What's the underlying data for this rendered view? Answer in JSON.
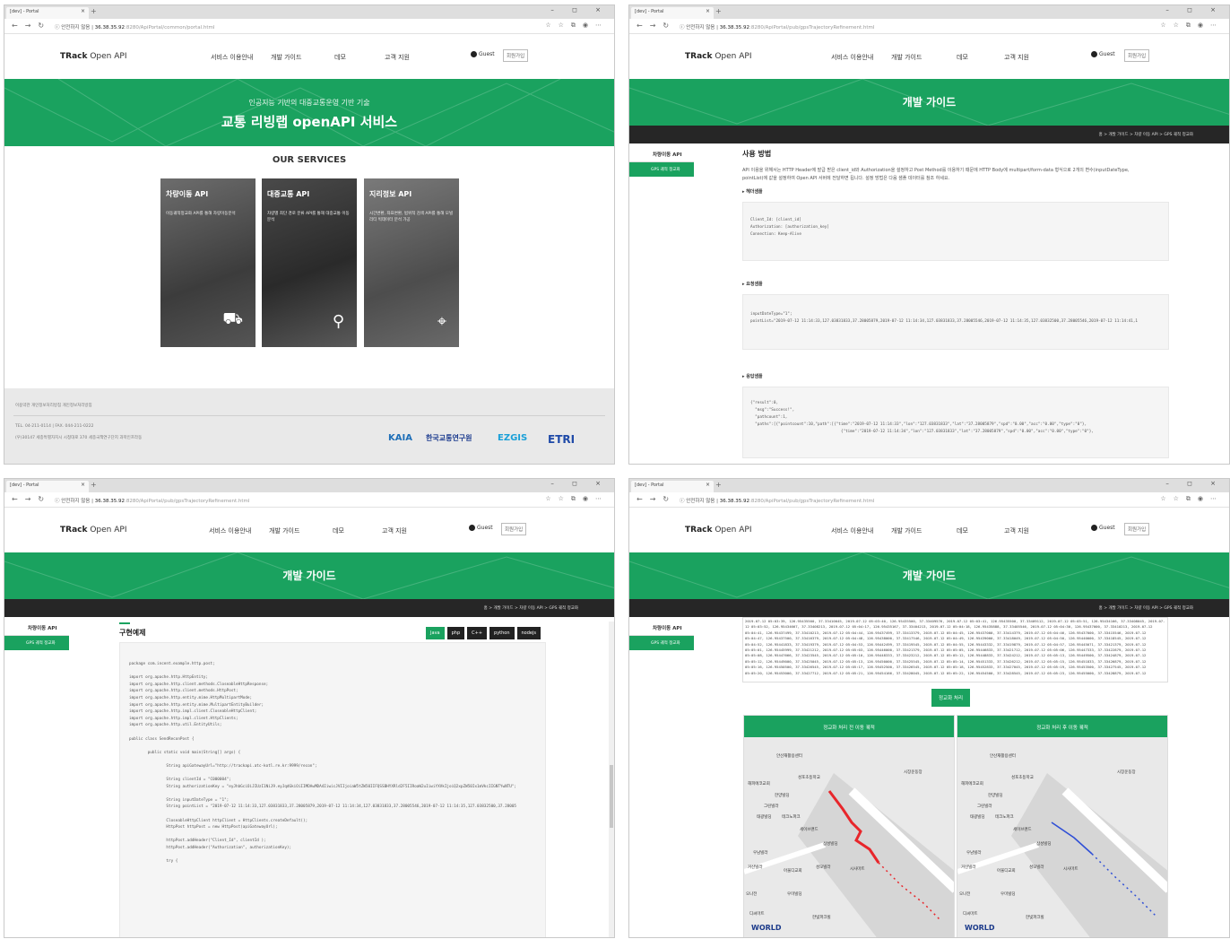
{
  "browser": {
    "tab_label": "[dev] - Portal",
    "tab_close": "×",
    "new_tab": "+",
    "window_controls": "–  ◻  ×",
    "not_secure": "안전하지 않음",
    "host": "36.38.35.92",
    "port_path_portal": ":8280/ApiPortal/common/portal.html",
    "port_path_guide": ":8280/ApiPortal/pub/gpsTrajectoryRefinement.html"
  },
  "site": {
    "logo_bold": "TRack",
    "logo_rest": " Open API",
    "menu": [
      "서비스 이용안내",
      "개발 가이드",
      "데모",
      "고객 지원"
    ],
    "guest": "Guest",
    "join": "회원가입"
  },
  "portal": {
    "hero_sub": "인공지능 기반의 대중교통운영 기반 기술",
    "hero_title": "교통 리빙랩 openAPI 서비스",
    "services_title": "OUR SERVICES",
    "cards": [
      {
        "title": "차량이동 API",
        "desc": "이동궤적정교화 API를 통해 차량이동분석"
      },
      {
        "title": "대중교통 API",
        "desc": "차량별 최단 경로 분류 API를 통해 대중교통 이동분석"
      },
      {
        "title": "지리정보 API",
        "desc": "시간변환, 좌표변환, 범위적 검색 API를 통해 모빌리티 빅데이터 분석 가공"
      }
    ],
    "footer_links": "이용약관   개인정보처리방침   개인정보처리방침",
    "footer_tel": "TEL. 04-211-0114  |  FAX. 044-211-0222",
    "footer_addr": "(우)30147 세종특별자치시 시청대로 370 세종국책연구단지 과학인프라동",
    "partners": [
      "KAIA",
      "한국교통연구원",
      "EZGIS",
      "ETRI"
    ]
  },
  "guide": {
    "page_title": "개발 가이드",
    "breadcrumb": "홈 > 개발 가이드 > 차량 이동 API > GPS 궤적 정교화",
    "side_menu": "차량이동 API",
    "side_active": "GPS 궤적 정교화",
    "usage_title": "사용 방법",
    "usage_text_1": "API 이용을 위해서는 HTTP Header에 발급 받은 client_id와 Authorization을 설정하고 Post Method를 이용하기 때문에 HTTP Body에 multipart/form-data 형식으로 2개의 변수(inputDateType,",
    "usage_text_2": "pointList)에 값을 설정하여 Open API 서버에 전달하면 됩니다. 설정 방법은 다음 샘플 데이터를 참조 하세요.",
    "header_sample_label": "▸ 헤더샘플",
    "header_sample": "Client_Id: [client_id]\nAuthorization: [authorization_key]\nConnection: Keep-Alive",
    "request_sample_label": "▸ 요청샘플",
    "request_sample": "inputDateType=\"1\";\npointList=\"2019-07-12 11:14:33,127.03831833,37.28005879,2019-07-12 11:14:34,127.03831833,37.28005546,2019-07-12 11:14:35,127.03832500,37.28005546,2019-07-12 11:14:41,1",
    "response_sample_label": "▸ 응답샘플",
    "response_sample": "{\"result\":0,\n  \"msg\":\"Success!\",\n  \"pathcount\":1,\n  \"paths\":[{\"pointcount\":10,\"path\":[{\"time\":\"2019-07-12 11:14:33\",\"lon\":\"127.03831833\",\"lat\":\"37.28005879\",\"spd\":\"0.00\",\"acc\":\"0.00\",\"type\":\"0\"},\n                                       {\"time\":\"2019-07-12 11:14:34\",\"lon\":\"127.03831833\",\"lat\":\"37.28005879\",\"spd\":\"0.00\",\"acc\":\"0.00\",\"type\":\"0\"},",
    "impl_title": "구현예제",
    "languages": [
      "Java",
      "php",
      "C++",
      "python",
      "nodejs"
    ],
    "java_code": "package com.incent.example.http.post;\n\nimport org.apache.http.HttpEntity;\nimport org.apache.http.client.methods.CloseableHttpResponse;\nimport org.apache.http.client.methods.HttpPost;\nimport org.apache.http.entity.mime.HttpMultipartMode;\nimport org.apache.http.entity.mime.MultipartEntityBuilder;\nimport org.apache.http.impl.client.CloseableHttpClient;\nimport org.apache.http.impl.client.HttpClients;\nimport org.apache.http.util.EntityUtils;\n\npublic class SendReconPost {\n\n        public static void main(String[] args) {\n\n                String apiGatewayUrl=\"http://trackapi.atc-kotl.re.kr:9999/recon\";\n\n                String clientId = \"C000004\";\n                String authorizationKey = \"eyJhbGciOiJIUzI1NiJ9.eyJqdGkiOiIIMDAwMDA4IiwicJVIIjoiaW5tZW50IIFQSSBHYXRld2F5IIRoaW2uIiwiYXVkIjoiQ2xpZW50Ix1mVkcIIGNTYwNTU\";\n\n                String inputDateType = \"1\";\n                String pointList = \"2019-07-12 11:14:33,127.03831833,37.28005879,2019-07-12 11:14:34,127.03831833,37.28005546,2019-07-12 11:14:35,127.03832500,37.28005\n\n                CloseableHttpClient httpClient = HttpClients.createDefault();\n                HttpPost httpPost = new HttpPost(apiGatewayUrl);\n\n                httpPost.addHeader(\"Client_Id\", clientId );\n                httpPost.addHeader(\"Authorization\", authorizationKey);\n\n                try {",
    "demo_output": "2019-07-12 05:03:39, 126.95435500, 37.33410045, 2019-07-12 05:03:40, 126.95435500, 37.33409576, 2019-07-12 05:03:41, 126.95435500, 37.33409112, 2019-07-12 05:03:51, 126.95434166, 37.33408045, 2019-07-\n12 05:03:52, 126.95434667, 37.33408213, 2019-07-12 05:04:17, 126.95435167, 37.33404213, 2019-07-12 05:04:18, 126.95435888, 37.33405546, 2019-07-12 05:04:30, 126.95437000, 37.33410213, 2019-07-12\n05:04:41, 126.95437499, 37.33410213, 2019-07-12 05:04:44, 126.95437499, 37.33413379, 2019-07-12 05:04:45, 126.95437000, 37.33414379, 2019-07-12 05:04:46, 126.95437000, 37.33415546, 2019-07-12\n05:04:47, 126.95437500, 37.33416379, 2019-07-12 05:04:48, 126.95438000, 37.33417546, 2019-07-12 05:04:49, 126.95439000, 37.33418049, 2019-07-12 05:04:50, 126.95440000, 37.33418545, 2019-07-12\n05:04:52, 126.95441833, 37.33419379, 2019-07-12 05:04:53, 126.95442499, 37.33419545, 2019-07-12 05:04:55, 126.95443332, 37.33419879, 2019-07-12 05:04:57, 126.95445071, 37.33421379, 2019-07-12\n05:05:01, 126.95445999, 37.33421212, 2019-07-12 05:05:03, 126.95446000, 37.33421379, 2019-07-12 05:05:05, 126.95446833, 37.33421712, 2019-07-12 05:05:06, 126.95447333, 37.33422879, 2019-07-12\n05:05:08, 126.95447666, 37.33423545, 2019-07-12 05:05:10, 126.95448333, 37.33423212, 2019-07-12 05:05:12, 126.95448833, 37.33424212, 2019-07-12 05:05:13, 126.95449500, 37.33424879, 2019-07-12\n05:05:12, 126.95449000, 37.33425045, 2019-07-12 05:05:13, 126.95450000, 37.33425545, 2019-07-12 05:05:14, 126.95451333, 37.33426212, 2019-07-12 05:05:15, 126.95451833, 37.33426879, 2019-07-12\n05:05:16, 126.95450500, 37.33426545, 2019-07-12 05:05:17, 126.95452500, 37.33426545, 2019-07-12 05:05:18, 126.95452833, 37.33427045, 2019-07-12 05:05:19, 126.95453500, 37.33427545, 2019-07-12\n05:05:20, 126.95453000, 37.33427712, 2019-07-12 05:05:21, 126.95454166, 37.33428045, 2019-07-12 05:05:22, 126.95454500, 37.33428545, 2019-07-12 05:05:23, 126.95455000, 37.33428879, 2019-07-12",
    "refine_button": "정교화 처리",
    "map_before": "정교화 처리 전 이동 궤적",
    "map_after": "정교화 처리 후 이동 궤적",
    "map_labels": [
      "안산재활용센터",
      "성포초등학교",
      "한양빌딩",
      "해피에코교회",
      "그린빌라",
      "태광빌딩",
      "테크노파크",
      "세이브랜드",
      "삼성빌딩",
      "우남빌라",
      "거산빌라",
      "아울디교회",
      "성모빌라",
      "시사마트",
      "오나전",
      "우미빌딩",
      "한빛파크빌",
      "디씨마트",
      "시장운동장"
    ],
    "map_logo": "WORLD"
  },
  "colors": {
    "brand_green": "#1aa25f",
    "dark_bar": "#262626",
    "track_red": "#e8262b",
    "track_blue": "#2f4fd6"
  },
  "icons": {
    "car": "car-icon",
    "route": "route-icon",
    "map_pin": "map-pin-icon"
  }
}
